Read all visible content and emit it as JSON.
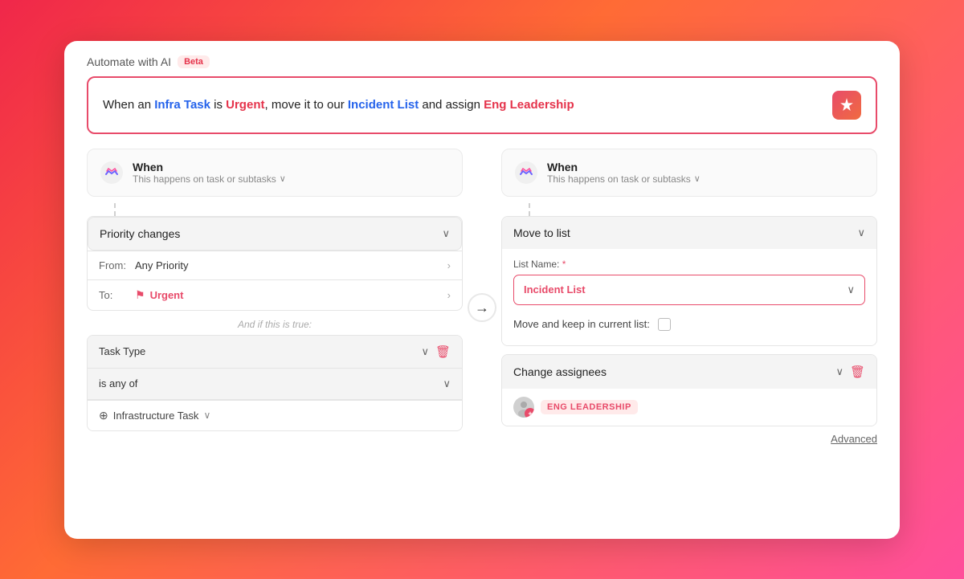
{
  "header": {
    "automate_label": "Automate with AI",
    "beta_label": "Beta"
  },
  "prompt": {
    "text_before": "When an ",
    "highlight1": "Infra Task",
    "text_middle1": " is ",
    "highlight2": "Urgent",
    "text_middle2": ", move it to our ",
    "highlight3": "Incident List",
    "text_middle3": " and assign ",
    "highlight4": "Eng Leadership"
  },
  "left_column": {
    "when_title": "When",
    "when_subtitle": "This happens on task or subtasks",
    "trigger_label": "Priority changes",
    "from_label": "From:",
    "from_value": "Any Priority",
    "to_label": "To:",
    "to_value": "Urgent",
    "and_if_label": "And if this is true:",
    "condition_label": "Task Type",
    "condition_sub_label": "is any of",
    "infra_label": "Infrastructure Task"
  },
  "right_column": {
    "when_title": "When",
    "when_subtitle": "This happens on task or subtasks",
    "action_label": "Move to list",
    "list_name_label": "List Name:",
    "list_name_required": "*",
    "incident_list": "Incident List",
    "keep_label": "Move and keep in current list:",
    "assignees_label": "Change assignees",
    "eng_badge": "ENG LEADERSHIP",
    "advanced_label": "Advanced"
  },
  "icons": {
    "chevron_down": "∨",
    "chevron_right": "›",
    "delete": "🗑",
    "globe": "⊕",
    "arrow_right": "→",
    "sparkle": "✦",
    "flag": "⚑"
  }
}
